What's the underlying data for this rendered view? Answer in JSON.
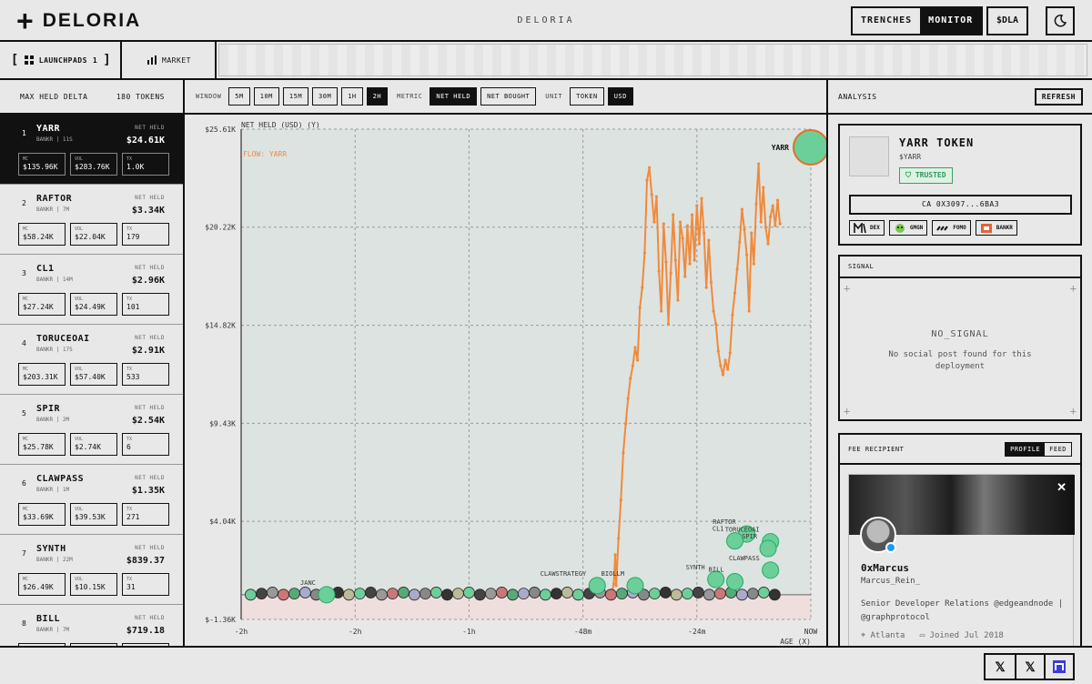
{
  "header": {
    "brand": "DELORIA",
    "center_title": "DELORIA",
    "modes": [
      "TRENCHES",
      "MONITOR"
    ],
    "active_mode": "MONITOR",
    "ticker_button": "$DLA"
  },
  "subnav": {
    "launchpads_label": "LAUNCHPADS",
    "launchpads_count": "1",
    "market_label": "MARKET"
  },
  "sidebar": {
    "title": "MAX HELD DELTA",
    "count": "180 TOKENS",
    "tokens": [
      {
        "rank": "1",
        "name": "YARR",
        "meta": "BANKR | 11S",
        "net_label": "NET HELD",
        "net": "$24.61K",
        "mc": "$135.96K",
        "vol": "$283.76K",
        "tx": "1.0K"
      },
      {
        "rank": "2",
        "name": "RAFTOR",
        "meta": "BANKR | 7M",
        "net_label": "NET HELD",
        "net": "$3.34K",
        "mc": "$58.24K",
        "vol": "$22.04K",
        "tx": "179"
      },
      {
        "rank": "3",
        "name": "CL1",
        "meta": "BANKR | 14M",
        "net_label": "NET HELD",
        "net": "$2.96K",
        "mc": "$27.24K",
        "vol": "$24.49K",
        "tx": "101"
      },
      {
        "rank": "4",
        "name": "TORUCEOAI",
        "meta": "BANKR | 17S",
        "net_label": "NET HELD",
        "net": "$2.91K",
        "mc": "$203.31K",
        "vol": "$57.40K",
        "tx": "533"
      },
      {
        "rank": "5",
        "name": "SPIR",
        "meta": "BANKR | 2M",
        "net_label": "NET HELD",
        "net": "$2.54K",
        "mc": "$25.78K",
        "vol": "$2.74K",
        "tx": "6"
      },
      {
        "rank": "6",
        "name": "CLAWPASS",
        "meta": "BANKR | 1M",
        "net_label": "NET HELD",
        "net": "$1.35K",
        "mc": "$33.69K",
        "vol": "$39.53K",
        "tx": "271"
      },
      {
        "rank": "7",
        "name": "SYNTH",
        "meta": "BANKR | 22M",
        "net_label": "NET HELD",
        "net": "$839.37",
        "mc": "$26.49K",
        "vol": "$10.15K",
        "tx": "31"
      },
      {
        "rank": "8",
        "name": "BILL",
        "meta": "BANKR | 7M",
        "net_label": "NET HELD",
        "net": "$719.18",
        "mc": "",
        "vol": "",
        "tx": ""
      }
    ],
    "stat_labels": {
      "mc": "MC",
      "vol": "VOL",
      "tx": "TX"
    }
  },
  "controls": {
    "window_label": "WINDOW",
    "windows": [
      "5M",
      "10M",
      "15M",
      "30M",
      "1H",
      "2H"
    ],
    "active_window": "2H",
    "metric_label": "METRIC",
    "metrics": [
      "NET HELD",
      "NET BOUGHT"
    ],
    "active_metric": "NET HELD",
    "unit_label": "UNIT",
    "units": [
      "TOKEN",
      "USD"
    ],
    "active_unit": "USD"
  },
  "chart_data": {
    "type": "line",
    "ylabel": "NET HELD (USD) (Y)",
    "xlabel": "AGE (X)",
    "flow_label": "FLOW: YARR",
    "y_ticks": [
      "$25.61K",
      "$20.22K",
      "$14.82K",
      "$9.43K",
      "$4.04K",
      "$-1.36K"
    ],
    "y_tick_values": [
      25610,
      20220,
      14820,
      9430,
      4040,
      -1360
    ],
    "x_ticks": [
      "-2h",
      "-2h",
      "-1h",
      "-48m",
      "-24m",
      "NOW"
    ],
    "x_tick_minutes": [
      -120,
      -96,
      -72,
      -48,
      -24,
      0
    ],
    "ylim": [
      -1360,
      25610
    ],
    "xlim": [
      -120,
      0
    ],
    "series": [
      {
        "name": "YARR",
        "color": "#f08a3c",
        "points": [
          [
            -42,
            0
          ],
          [
            -41.5,
            600
          ],
          [
            -41.2,
            2200
          ],
          [
            -41,
            500
          ],
          [
            -40.5,
            3100
          ],
          [
            -40,
            5200
          ],
          [
            -39.5,
            7800
          ],
          [
            -39,
            9400
          ],
          [
            -38.5,
            10800
          ],
          [
            -38,
            11900
          ],
          [
            -37.5,
            12600
          ],
          [
            -37,
            13600
          ],
          [
            -36.5,
            12900
          ],
          [
            -36,
            15800
          ],
          [
            -35.5,
            16900
          ],
          [
            -35,
            18800
          ],
          [
            -34.5,
            22800
          ],
          [
            -34,
            23500
          ],
          [
            -33.5,
            22000
          ],
          [
            -33,
            20500
          ],
          [
            -32.5,
            21900
          ],
          [
            -32,
            17800
          ],
          [
            -31.5,
            15600
          ],
          [
            -31,
            20400
          ],
          [
            -30.5,
            18300
          ],
          [
            -30,
            14900
          ],
          [
            -29.5,
            17700
          ],
          [
            -29,
            20900
          ],
          [
            -28.5,
            18400
          ],
          [
            -28,
            16200
          ],
          [
            -27.5,
            20500
          ],
          [
            -27,
            19600
          ],
          [
            -26.5,
            17500
          ],
          [
            -26,
            20300
          ],
          [
            -25.5,
            18200
          ],
          [
            -25,
            20900
          ],
          [
            -24.5,
            18400
          ],
          [
            -24,
            21400
          ],
          [
            -23.5,
            19300
          ],
          [
            -23,
            21800
          ],
          [
            -22.5,
            19900
          ],
          [
            -22,
            16900
          ],
          [
            -21.5,
            19500
          ],
          [
            -21,
            17200
          ],
          [
            -20.5,
            15600
          ],
          [
            -20,
            14900
          ],
          [
            -19.5,
            13400
          ],
          [
            -19,
            12600
          ],
          [
            -18.5,
            12100
          ],
          [
            -18,
            12900
          ],
          [
            -17.5,
            12400
          ],
          [
            -17,
            13300
          ],
          [
            -16.5,
            15400
          ],
          [
            -16,
            16600
          ],
          [
            -15.5,
            17900
          ],
          [
            -15,
            19400
          ],
          [
            -14.5,
            21200
          ],
          [
            -14,
            20100
          ],
          [
            -13.5,
            18700
          ],
          [
            -13,
            15600
          ],
          [
            -12.5,
            19900
          ],
          [
            -12,
            18200
          ],
          [
            -11.5,
            21500
          ],
          [
            -11,
            23700
          ],
          [
            -10.5,
            20500
          ],
          [
            -10,
            22400
          ],
          [
            -9.5,
            20200
          ],
          [
            -9,
            19300
          ],
          [
            -8.5,
            20800
          ],
          [
            -8,
            21400
          ],
          [
            -7.5,
            20300
          ],
          [
            -7,
            21700
          ],
          [
            -6.5,
            20400
          ]
        ]
      }
    ],
    "highlight_marker": {
      "name": "YARR",
      "x": 0,
      "y": 24610,
      "color": "#6ccf99"
    },
    "bubble_labels": [
      {
        "name": "RAFTOR",
        "x": -13.5,
        "y": 3340
      },
      {
        "name": "CL1",
        "x": -16,
        "y": 2960
      },
      {
        "name": "TORUCEOAI",
        "x": -8.5,
        "y": 2910
      },
      {
        "name": "SPIR",
        "x": -9,
        "y": 2540
      },
      {
        "name": "CLAWPASS",
        "x": -8.5,
        "y": 1350
      },
      {
        "name": "SYNTH",
        "x": -20,
        "y": 839
      },
      {
        "name": "BILL",
        "x": -16,
        "y": 719
      },
      {
        "name": "CLAWSTRATEGY",
        "x": -45,
        "y": 500
      },
      {
        "name": "JANC",
        "x": -102,
        "y": 0
      },
      {
        "name": "BIOLLM",
        "x": -37,
        "y": 500
      }
    ]
  },
  "analysis": {
    "title": "ANALYSIS",
    "refresh": "REFRESH",
    "token_name": "YARR TOKEN",
    "token_symbol": "$YARR",
    "trust": "TRUSTED",
    "ca": "CA 0X3097...6BA3",
    "links": [
      "DEX",
      "GMGN",
      "FOMO",
      "BANKR"
    ]
  },
  "signal": {
    "title": "SIGNAL",
    "status": "NO_SIGNAL",
    "message": "No social post found for this deployment"
  },
  "fee": {
    "title": "FEE RECIPIENT",
    "tabs": [
      "PROFILE",
      "FEED"
    ],
    "active_tab": "PROFILE",
    "name": "0xMarcus",
    "handle": "Marcus_Rein_",
    "bio": "Senior Developer Relations @edgeandnode | @graphprotocol",
    "location": "Atlanta",
    "joined": "Joined Jul 2018"
  },
  "footer": {
    "social_icons": [
      "x-icon",
      "x-icon",
      "app-icon"
    ]
  }
}
